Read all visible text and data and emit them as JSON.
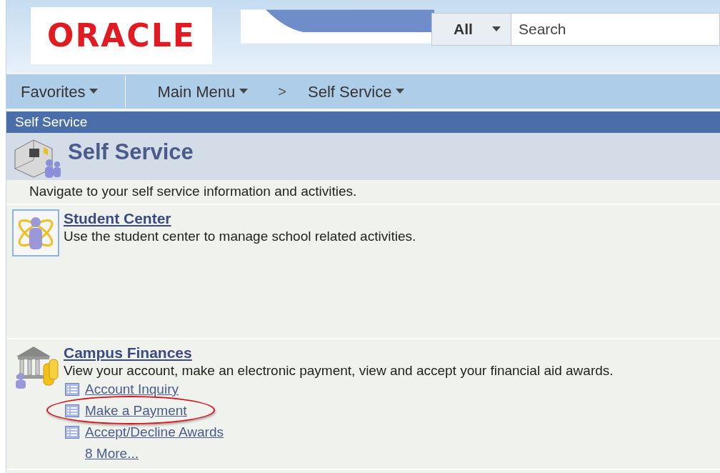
{
  "header": {
    "logo": "ORACLE",
    "search_scope": "All",
    "search": {
      "placeholder": "Search"
    }
  },
  "nav": [
    {
      "kind": "menu",
      "label": "Favorites"
    },
    {
      "kind": "menu",
      "label": "Main Menu"
    },
    {
      "kind": "separator",
      "label": ">"
    },
    {
      "kind": "menu",
      "label": "Self Service"
    }
  ],
  "title_bar": "Self Service",
  "page": {
    "title": "Self Service",
    "description": "Navigate to your self service information and activities."
  },
  "sections": [
    {
      "kind": "student",
      "title": "Student Center",
      "description": "Use the student center to manage school related activities."
    },
    {
      "kind": "finance",
      "title": "Campus Finances",
      "description": "View your account, make an electronic payment, view and accept your financial aid awards.",
      "links": [
        {
          "label": "Account Inquiry",
          "highlighted": false
        },
        {
          "label": "Make a Payment",
          "highlighted": true
        },
        {
          "label": "Accept/Decline Awards",
          "highlighted": false
        }
      ],
      "more": "8 More..."
    }
  ]
}
